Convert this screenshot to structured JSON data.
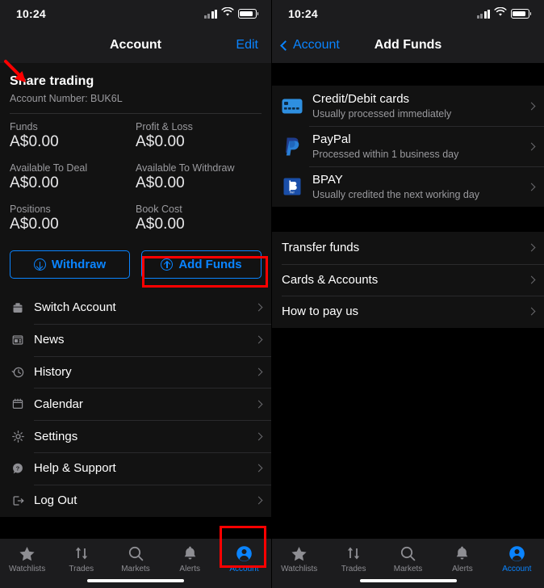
{
  "colors": {
    "accent": "#0a84ff",
    "annotation": "#ff0000",
    "panel": "#121212",
    "bar": "#1c1c1e",
    "muted": "#9a9a9e"
  },
  "statusbar": {
    "time": "10:24",
    "signal_icon": "cellular-bars-icon",
    "wifi_icon": "wifi-icon",
    "battery_icon": "battery-icon"
  },
  "left": {
    "nav": {
      "title": "Account",
      "right_action": "Edit"
    },
    "account": {
      "name": "Share trading",
      "number_label": "Account Number: BUK6L",
      "stats": [
        {
          "label": "Funds",
          "value": "A$0.00"
        },
        {
          "label": "Profit & Loss",
          "value": "A$0.00"
        },
        {
          "label": "Available To Deal",
          "value": "A$0.00"
        },
        {
          "label": "Available To Withdraw",
          "value": "A$0.00"
        },
        {
          "label": "Positions",
          "value": "A$0.00"
        },
        {
          "label": "Book Cost",
          "value": "A$0.00"
        }
      ]
    },
    "buttons": [
      {
        "label": "Withdraw",
        "icon": "circle-arrow-down-icon"
      },
      {
        "label": "Add Funds",
        "icon": "circle-arrow-up-icon"
      }
    ],
    "menu": [
      {
        "label": "Switch Account",
        "icon": "briefcase-icon"
      },
      {
        "label": "News",
        "icon": "newspaper-icon"
      },
      {
        "label": "History",
        "icon": "clock-history-icon"
      },
      {
        "label": "Calendar",
        "icon": "calendar-icon"
      },
      {
        "label": "Settings",
        "icon": "gear-icon"
      },
      {
        "label": "Help & Support",
        "icon": "question-mark-icon"
      },
      {
        "label": "Log Out",
        "icon": "logout-icon"
      }
    ]
  },
  "right": {
    "nav": {
      "back_label": "Account",
      "title": "Add Funds"
    },
    "payment_methods": [
      {
        "title": "Credit/Debit cards",
        "subtitle": "Usually processed immediately",
        "icon": "credit-card-icon"
      },
      {
        "title": "PayPal",
        "subtitle": "Processed within 1 business day",
        "icon": "paypal-icon"
      },
      {
        "title": "BPAY",
        "subtitle": "Usually credited the next working day",
        "icon": "bpay-icon"
      }
    ],
    "other_options": [
      {
        "label": "Transfer funds"
      },
      {
        "label": "Cards & Accounts"
      },
      {
        "label": "How to pay us"
      }
    ]
  },
  "tabs": [
    {
      "label": "Watchlists",
      "icon": "star-icon",
      "active": false
    },
    {
      "label": "Trades",
      "icon": "arrows-up-down-icon",
      "active": false
    },
    {
      "label": "Markets",
      "icon": "search-icon",
      "active": false
    },
    {
      "label": "Alerts",
      "icon": "bell-icon",
      "active": false
    },
    {
      "label": "Account",
      "icon": "person-circle-icon",
      "active": true
    }
  ],
  "annotations": {
    "arrow": "red-arrow-pointing-to-account-header",
    "highlight_add_funds": "Add Funds",
    "highlight_account_tab": "Account"
  }
}
